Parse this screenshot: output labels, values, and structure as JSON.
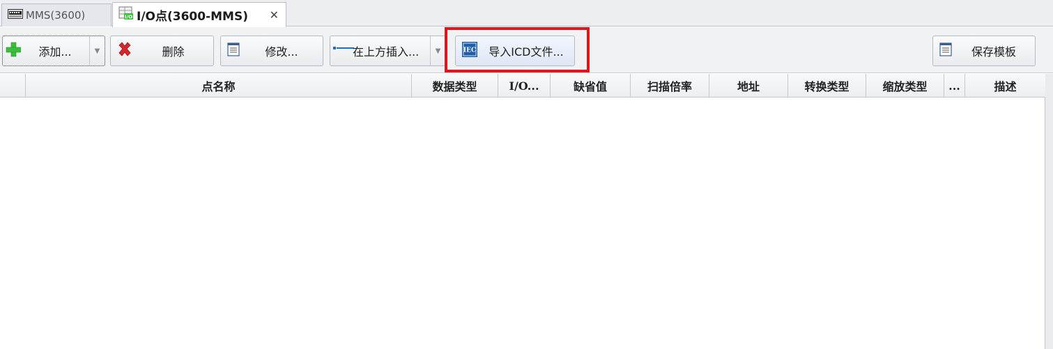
{
  "tabs": [
    {
      "label": "MMS(3600)",
      "icon": "device-icon",
      "active": false
    },
    {
      "label": "I/O点(3600-MMS)",
      "icon": "io-table-icon",
      "active": true,
      "close": "✕"
    }
  ],
  "toolbar": {
    "add_label": "添加...",
    "delete_label": "删除",
    "modify_label": "修改...",
    "insert_above_label": "在上方插入...",
    "import_icd_label": "导入ICD文件...",
    "import_icd_icon_text": "IEC",
    "save_template_label": "保存模板"
  },
  "grid": {
    "columns": [
      "",
      "点名称",
      "数据类型",
      "I/O...",
      "缺省值",
      "扫描倍率",
      "地址",
      "转换类型",
      "缩放类型",
      "...",
      "描述"
    ],
    "rows": []
  },
  "colors": {
    "highlight": "#e0161c",
    "add_icon": "#3bbf3a",
    "delete_icon": "#d9262c",
    "iec_icon": "#1f5fa8"
  }
}
